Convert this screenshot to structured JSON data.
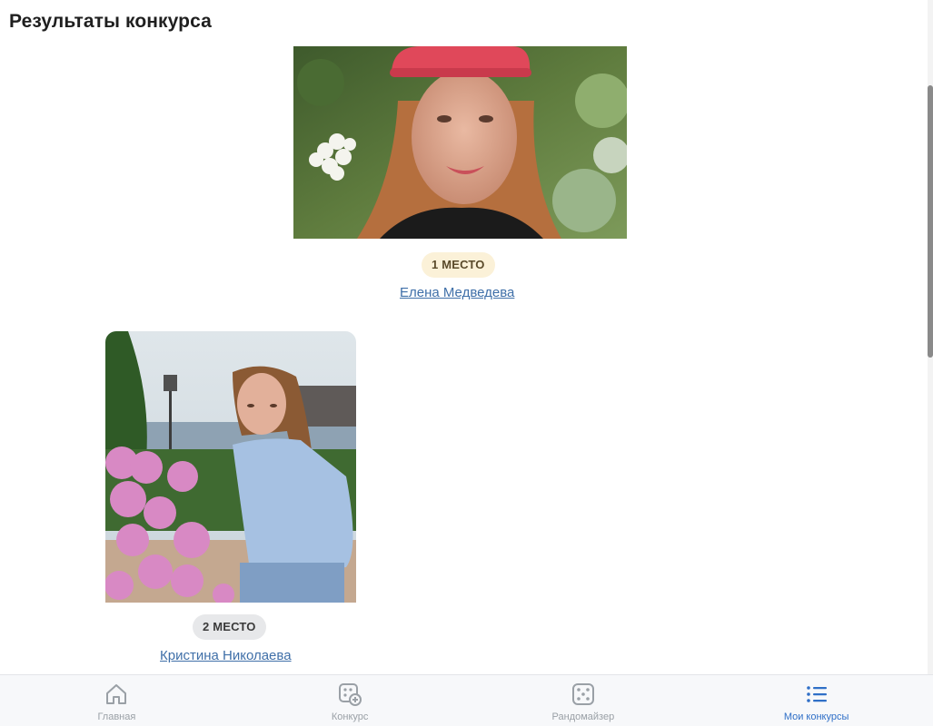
{
  "page": {
    "title": "Результаты конкурса"
  },
  "results": [
    {
      "place_label": "1 место",
      "name": "Елена Медведева"
    },
    {
      "place_label": "2 место",
      "name": "Кристина Николаева"
    }
  ],
  "nav": {
    "items": [
      {
        "label": "Главная",
        "icon": "home-icon",
        "active": false
      },
      {
        "label": "Конкурс",
        "icon": "contest-add-icon",
        "active": false
      },
      {
        "label": "Рандомайзер",
        "icon": "dice-icon",
        "active": false
      },
      {
        "label": "Мои конкурсы",
        "icon": "list-icon",
        "active": true
      }
    ]
  },
  "colors": {
    "link": "#3f6fa8",
    "nav_active": "#2f6fc7",
    "nav_inactive": "#9aa0a6",
    "badge_first": "#fbf1d8",
    "badge_second": "#e7e8ea"
  }
}
